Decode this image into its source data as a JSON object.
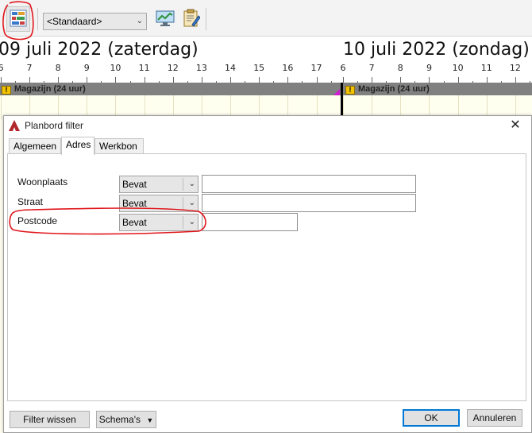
{
  "toolbar": {
    "view_select_value": "<Standaard>",
    "buttons": [
      {
        "icon": "planbord-filter-icon"
      },
      {
        "icon": "monitor-chart-icon"
      },
      {
        "icon": "clipboard-edit-icon"
      }
    ]
  },
  "calendar": {
    "day1_label": "09 juli 2022 (zaterdag)",
    "day2_label": "10 juli 2022 (zondag)",
    "hours_left_edge": "6",
    "hours_day1": [
      "7",
      "8",
      "9",
      "10",
      "11",
      "12",
      "13",
      "14",
      "15",
      "16",
      "17"
    ],
    "hours_day2": [
      "6",
      "7",
      "8",
      "9",
      "10",
      "11",
      "12"
    ],
    "resource_day1": "Magazijn (24 uur)",
    "resource_day2": "Magazijn (24 uur)",
    "warning_glyph": "!",
    "colors": {
      "now_line": "#000000",
      "now_marker": "#d01bd0",
      "resource_bar": "#808080",
      "background": "#fffff0"
    }
  },
  "dialog": {
    "title": "Planbord filter",
    "close_glyph": "✕",
    "tabs": [
      {
        "label": "Algemeen",
        "selected": false
      },
      {
        "label": "Adres",
        "selected": true
      },
      {
        "label": "Werkbon",
        "selected": false
      }
    ],
    "fields": [
      {
        "label": "Woonplaats",
        "operator": "Bevat",
        "value": ""
      },
      {
        "label": "Straat",
        "operator": "Bevat",
        "value": ""
      },
      {
        "label": "Postcode",
        "operator": "Bevat",
        "value": ""
      }
    ],
    "buttons": {
      "clear": "Filter wissen",
      "schemas": "Schema's",
      "ok": "OK",
      "cancel": "Annuleren"
    },
    "colors": {
      "default_button_border": "#0078d7",
      "annotation": "#e0161b"
    }
  }
}
